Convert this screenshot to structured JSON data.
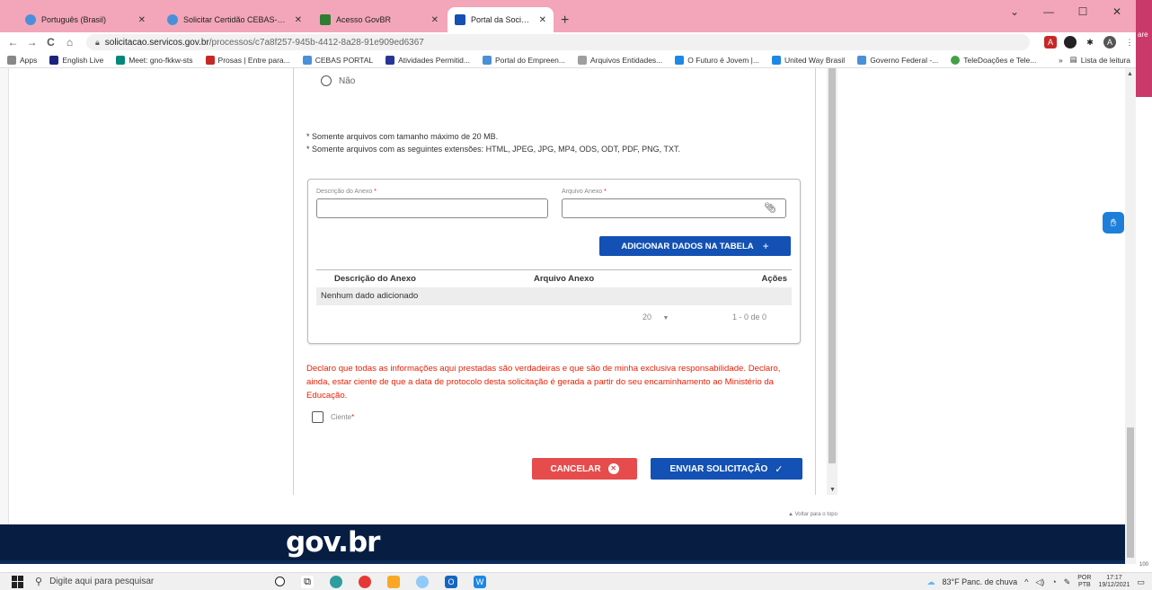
{
  "browser": {
    "tabs": [
      {
        "title": "Português (Brasil)",
        "color": "#4a90d9"
      },
      {
        "title": "Solicitar Certidão CEBAS-Educaçã",
        "color": "#4a90d9"
      },
      {
        "title": "Acesso GovBR",
        "color": "#2e7d32"
      },
      {
        "title": "Portal da Sociedade - Informar D",
        "color": "#1351b4"
      }
    ],
    "new_tab": "+",
    "window_controls": {
      "collapse": "⌄",
      "minimize": "—",
      "maximize": "☐",
      "close": "✕"
    },
    "side_text": "are",
    "nav": {
      "back": "←",
      "forward": "→",
      "reload": "C",
      "home": "⌂"
    },
    "url_domain": "solicitacao.servicos.gov.br",
    "url_path": "/processos/c7a8f257-945b-4412-8a28-91e909ed6367",
    "bookmarks": [
      {
        "label": "Apps",
        "color": "#888888"
      },
      {
        "label": "English Live",
        "color": "#1a237e"
      },
      {
        "label": "Meet: gno-fkkw-sts",
        "color": "#00897b"
      },
      {
        "label": "Prosas | Entre para...",
        "color": "#c62828"
      },
      {
        "label": "CEBAS PORTAL",
        "color": "#4a90d9"
      },
      {
        "label": "Atividades Permitid...",
        "color": "#283593"
      },
      {
        "label": "Portal do Empreen...",
        "color": "#4a90d9"
      },
      {
        "label": "Arquivos Entidades...",
        "color": "#9e9e9e"
      },
      {
        "label": "O Futuro é Jovem |...",
        "color": "#1e88e5"
      },
      {
        "label": "United Way Brasil",
        "color": "#1e88e5"
      },
      {
        "label": "Governo Federal -...",
        "color": "#4a90d9"
      },
      {
        "label": "TeleDoações e Tele...",
        "color": "#43a047"
      }
    ],
    "bookmarks_more": "»",
    "reading_list": "Lista de leitura"
  },
  "form": {
    "radio_no_label": "Não",
    "note_size": "* Somente arquivos com tamanho máximo de 20 MB.",
    "note_ext": "* Somente arquivos com as seguintes extensões: HTML, JPEG, JPG, MP4, ODS, ODT, PDF, PNG, TXT.",
    "desc_label": "Descrição do Anexo",
    "file_label": "Arquivo Anexo",
    "required_mark": "*",
    "add_button": "ADICIONAR DADOS NA TABELA",
    "add_plus": "+",
    "table": {
      "columns": [
        "Descrição do Anexo",
        "Arquivo Anexo",
        "Ações"
      ],
      "empty": "Nenhum dado adicionado"
    },
    "page_size": "20",
    "page_size_arrow": "▼",
    "range": "1 - 0 de 0",
    "declaration": "Declaro que todas as informações aqui prestadas são verdadeiras e que são de minha exclusiva responsabilidade. Declaro, ainda, estar ciente de que a data de protocolo desta solicitação é gerada a partir do seu encaminhamento ao Ministério da Educação.",
    "ciente_label": "Ciente",
    "cancel_button": "CANCELAR",
    "send_button": "ENVIAR SOLICITAÇÃO"
  },
  "back_to_top": "▲ Voltar para o topo",
  "footer_logo": "gov.br",
  "taskbar": {
    "search_placeholder": "Digite aqui para pesquisar",
    "weather": "83°F  Panc. de chuva",
    "lang_top": "POR",
    "lang_bottom": "PTB",
    "time": "17:17",
    "date": "19/12/2021"
  },
  "zoom_fragment": "100"
}
